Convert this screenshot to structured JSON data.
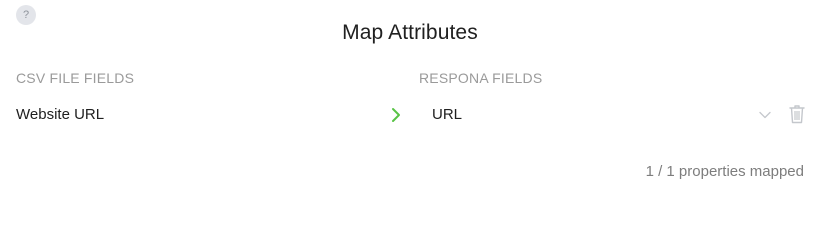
{
  "help": {
    "icon": "help-icon",
    "glyph": "?"
  },
  "title": "Map Attributes",
  "columns": {
    "csv_header": "CSV FILE FIELDS",
    "respona_header": "RESPONA FIELDS"
  },
  "rows": [
    {
      "csv_field": "Website URL",
      "arrow_icon": "chevron-right-icon",
      "respona_field": "URL",
      "select_icon": "chevron-down-icon",
      "delete_icon": "trash-icon"
    }
  ],
  "summary": "1 / 1 properties mapped",
  "colors": {
    "accent_green": "#58c345",
    "muted_text": "#9a9a9a",
    "icon_gray": "#c4c7cc"
  }
}
